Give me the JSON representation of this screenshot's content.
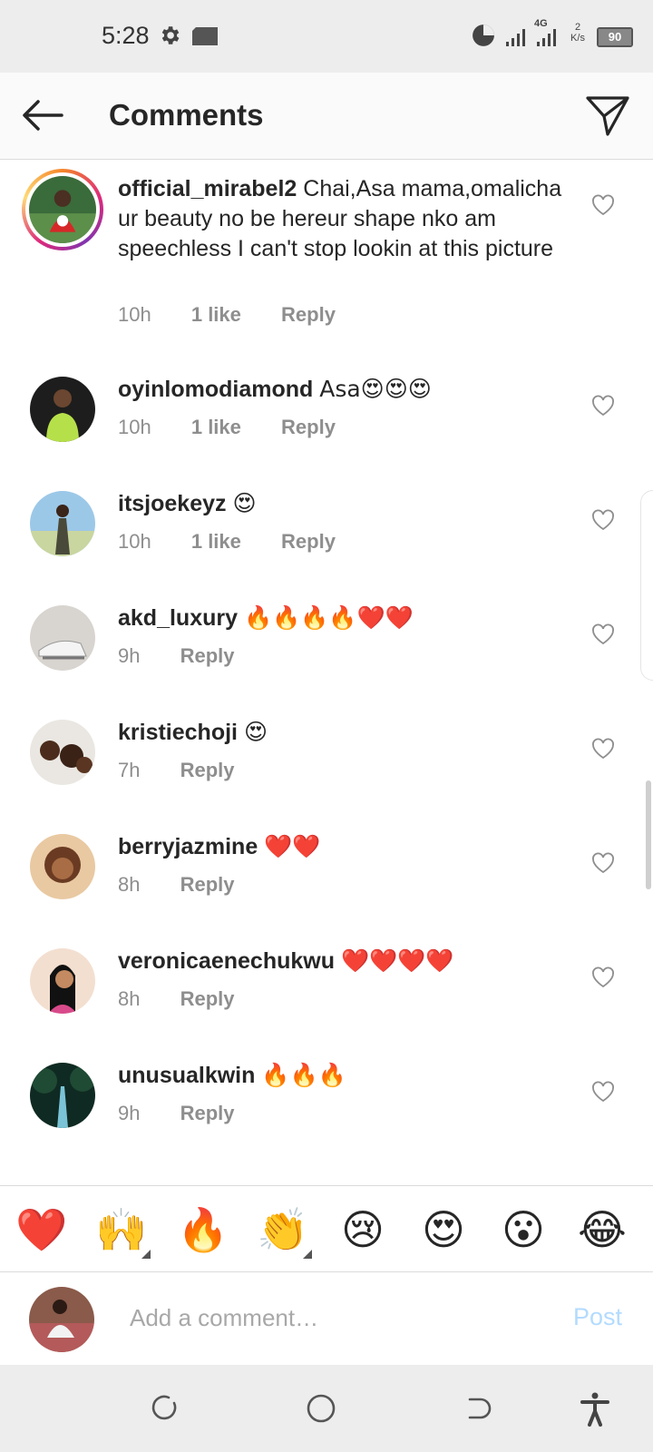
{
  "status_bar": {
    "time": "5:28",
    "network_type": "4G",
    "net_speed_value": "2",
    "net_speed_unit": "K/s",
    "battery": "90"
  },
  "header": {
    "title": "Comments"
  },
  "comments": [
    {
      "username": "official_mirabel2",
      "text": "Chai,Asa mama,omalicha ur beauty no be hereur shape nko am speechless I can't stop lookin at this picture",
      "time": "10h",
      "likes": "1 like",
      "reply": "Reply"
    },
    {
      "username": "oyinlomodiamond",
      "text": "Asa😍😍😍",
      "time": "10h",
      "likes": "1 like",
      "reply": "Reply"
    },
    {
      "username": "itsjoekeyz",
      "text": "😍",
      "time": "10h",
      "likes": "1 like",
      "reply": "Reply"
    },
    {
      "username": "akd_luxury",
      "text": "🔥🔥🔥🔥❤️❤️",
      "time": "9h",
      "reply": "Reply"
    },
    {
      "username": "kristiechoji",
      "text": "😍",
      "time": "7h",
      "reply": "Reply"
    },
    {
      "username": "berryjazmine",
      "text": "❤️❤️",
      "time": "8h",
      "reply": "Reply"
    },
    {
      "username": "veronicaenechukwu",
      "text": "❤️❤️❤️❤️",
      "time": "8h",
      "reply": "Reply"
    },
    {
      "username": "unusualkwin",
      "text": "🔥🔥🔥",
      "time": "9h",
      "reply": "Reply"
    }
  ],
  "quick_emojis": [
    "❤️",
    "🙌",
    "🔥",
    "👏",
    "😢",
    "😍",
    "😮",
    "😂"
  ],
  "composer": {
    "placeholder": "Add a comment…",
    "post_label": "Post"
  },
  "colors": {
    "accent_disabled": "#b3dbff",
    "secondary_text": "#8e8e8e",
    "primary_text": "#262626"
  }
}
